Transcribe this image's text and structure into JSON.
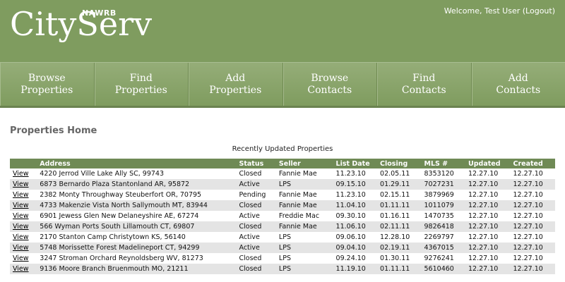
{
  "header": {
    "logo_text": "CityServ",
    "logo_subtext": "NAWRB",
    "welcome_text": "Welcome, Test User",
    "logout_label": "(Logout)"
  },
  "nav": [
    {
      "line1": "Browse",
      "line2": "Properties"
    },
    {
      "line1": "Find",
      "line2": "Properties"
    },
    {
      "line1": "Add",
      "line2": "Properties"
    },
    {
      "line1": "Browse",
      "line2": "Contacts"
    },
    {
      "line1": "Find",
      "line2": "Contacts"
    },
    {
      "line1": "Add",
      "line2": "Contacts"
    }
  ],
  "page": {
    "title": "Properties Home",
    "table_caption": "Recently Updated Properties"
  },
  "table": {
    "columns": [
      "",
      "Address",
      "Status",
      "Seller",
      "List Date",
      "Closing",
      "MLS #",
      "Updated",
      "Created"
    ],
    "view_label": "View",
    "rows": [
      [
        "4220 Jerrod Ville Lake Ally SC, 99743",
        "Closed",
        "Fannie Mae",
        "11.23.10",
        "02.05.11",
        "8353120",
        "12.27.10",
        "12.27.10"
      ],
      [
        "6873 Bernardo Plaza Stantonland AR, 95872",
        "Active",
        "LPS",
        "09.15.10",
        "01.29.11",
        "7027231",
        "12.27.10",
        "12.27.10"
      ],
      [
        "2382 Monty Throughway Steuberfort OR, 70795",
        "Pending",
        "Fannie Mae",
        "11.23.10",
        "02.15.11",
        "3879969",
        "12.27.10",
        "12.27.10"
      ],
      [
        "4733 Makenzie Vista North Sallymouth MT, 83944",
        "Closed",
        "Fannie Mae",
        "11.04.10",
        "01.11.11",
        "1011079",
        "12.27.10",
        "12.27.10"
      ],
      [
        "6901 Jewess Glen New Delaneyshire AE, 67274",
        "Active",
        "Freddie Mac",
        "09.30.10",
        "01.16.11",
        "1470735",
        "12.27.10",
        "12.27.10"
      ],
      [
        "566 Wyman Ports South Lillamouth CT, 69807",
        "Closed",
        "Fannie Mae",
        "11.06.10",
        "02.11.11",
        "9826418",
        "12.27.10",
        "12.27.10"
      ],
      [
        "2170 Stanton Camp Christytown KS, 56140",
        "Active",
        "LPS",
        "09.06.10",
        "12.28.10",
        "2269797",
        "12.27.10",
        "12.27.10"
      ],
      [
        "5748 Morissette Forest Madelineport CT, 94299",
        "Active",
        "LPS",
        "09.04.10",
        "02.19.11",
        "4367015",
        "12.27.10",
        "12.27.10"
      ],
      [
        "3247 Stroman Orchard Reynoldsberg WV, 81273",
        "Closed",
        "LPS",
        "09.24.10",
        "01.30.11",
        "9276241",
        "12.27.10",
        "12.27.10"
      ],
      [
        "9136 Moore Branch Bruenmouth MO, 21211",
        "Closed",
        "LPS",
        "11.19.10",
        "01.11.11",
        "5610460",
        "12.27.10",
        "12.27.10"
      ]
    ]
  }
}
